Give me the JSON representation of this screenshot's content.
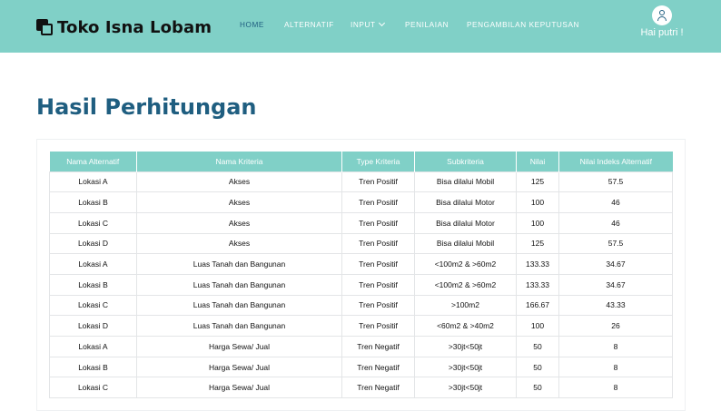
{
  "header": {
    "brand": "Toko Isna Lobam",
    "nav": [
      {
        "label": "HOME",
        "active": true
      },
      {
        "label": "ALTERNATIF",
        "active": false
      },
      {
        "label": "INPUT",
        "active": false,
        "dropdown": true
      },
      {
        "label": "PENILAIAN",
        "active": false
      },
      {
        "label": "PENGAMBILAN KEPUTUSAN",
        "active": false
      }
    ],
    "user_greeting": "Hai putri !"
  },
  "main": {
    "title": "Hasil Perhitungan",
    "table": {
      "columns": [
        "Nama Alternatif",
        "Nama Kriteria",
        "Type Kriteria",
        "Subkriteria",
        "Nilai",
        "Nilai Indeks Alternatif"
      ],
      "rows": [
        [
          "Lokasi A",
          "Akses",
          "Tren Positif",
          "Bisa dilalui Mobil",
          "125",
          "57.5"
        ],
        [
          "Lokasi B",
          "Akses",
          "Tren Positif",
          "Bisa dilalui Motor",
          "100",
          "46"
        ],
        [
          "Lokasi C",
          "Akses",
          "Tren Positif",
          "Bisa dilalui Motor",
          "100",
          "46"
        ],
        [
          "Lokasi D",
          "Akses",
          "Tren Positif",
          "Bisa dilalui Mobil",
          "125",
          "57.5"
        ],
        [
          "Lokasi A",
          "Luas Tanah dan Bangunan",
          "Tren Positif",
          "<100m2 & >60m2",
          "133.33",
          "34.67"
        ],
        [
          "Lokasi B",
          "Luas Tanah dan Bangunan",
          "Tren Positif",
          "<100m2 & >60m2",
          "133.33",
          "34.67"
        ],
        [
          "Lokasi C",
          "Luas Tanah dan Bangunan",
          "Tren Positif",
          ">100m2",
          "166.67",
          "43.33"
        ],
        [
          "Lokasi D",
          "Luas Tanah dan Bangunan",
          "Tren Positif",
          "<60m2 & >40m2",
          "100",
          "26"
        ],
        [
          "Lokasi A",
          "Harga Sewa/ Jual",
          "Tren Negatif",
          ">30jt<50jt",
          "50",
          "8"
        ],
        [
          "Lokasi B",
          "Harga Sewa/ Jual",
          "Tren Negatif",
          ">30jt<50jt",
          "50",
          "8"
        ],
        [
          "Lokasi C",
          "Harga Sewa/ Jual",
          "Tren Negatif",
          ">30jt<50jt",
          "50",
          "8"
        ]
      ]
    }
  },
  "colors": {
    "topbar": "#80d0c7",
    "accent": "#1f5e80",
    "header_text": "#ffffff"
  },
  "icons": {
    "brand": "stacked-squares-icon",
    "user": "user-icon",
    "dropdown": "chevron-down-icon"
  }
}
